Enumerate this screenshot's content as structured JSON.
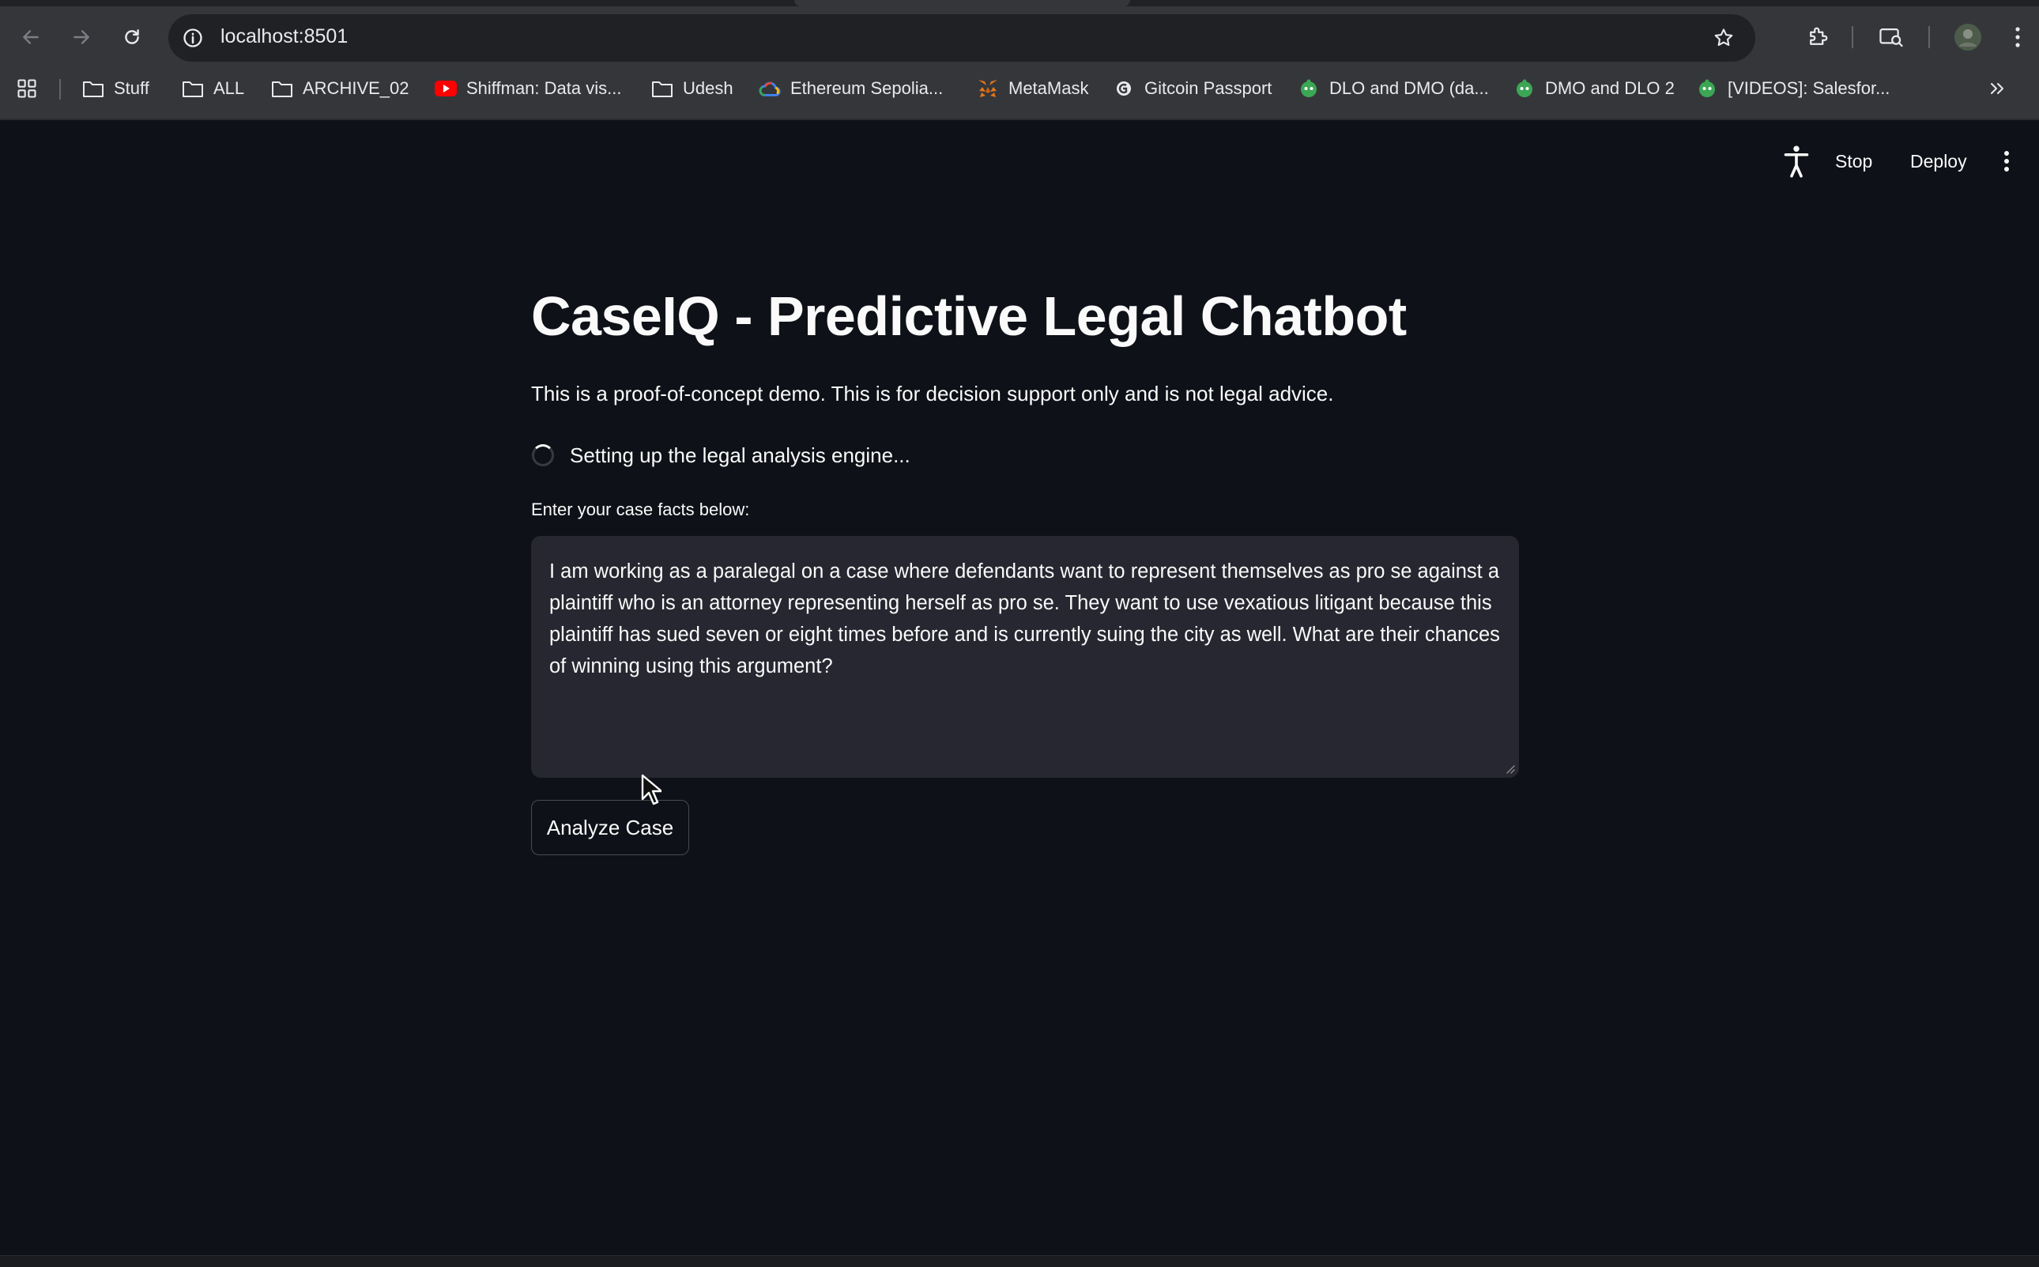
{
  "browser": {
    "url": "localhost:8501",
    "bookmarks": [
      {
        "label": "Stuff",
        "icon": "folder-icon"
      },
      {
        "label": "ALL",
        "icon": "folder-icon"
      },
      {
        "label": "ARCHIVE_02",
        "icon": "folder-icon"
      },
      {
        "label": "Shiffman: Data vis...",
        "icon": "youtube-icon"
      },
      {
        "label": "Udesh",
        "icon": "folder-icon"
      },
      {
        "label": "Ethereum Sepolia...",
        "icon": "google-cloud-icon"
      },
      {
        "label": "MetaMask",
        "icon": "metamask-fox-icon"
      },
      {
        "label": "Gitcoin Passport",
        "icon": "gitcoin-icon"
      },
      {
        "label": "DLO and DMO (da...",
        "icon": "salesforce-astro-icon"
      },
      {
        "label": "DMO and DLO 2",
        "icon": "salesforce-astro-icon"
      },
      {
        "label": "[VIDEOS]: Salesfor...",
        "icon": "salesforce-astro-icon"
      }
    ]
  },
  "app_header": {
    "stop_label": "Stop",
    "deploy_label": "Deploy"
  },
  "main": {
    "title": "CaseIQ - Predictive Legal Chatbot",
    "disclaimer": "This is a proof-of-concept demo. This is for decision support only and is not legal advice.",
    "status_text": "Setting up the legal analysis engine...",
    "input_label": "Enter your case facts below:",
    "case_facts": "I am working as a paralegal on a case where defendants want to represent themselves as pro se against a plaintiff who is an attorney representing herself as pro se. They want to use vexatious litigant because this plaintiff has sued seven or eight times before and is currently suing the city as well. What are their chances of winning using this argument?",
    "analyze_button_label": "Analyze Case"
  },
  "colors": {
    "app_background": "#0e1117",
    "text_area_background": "#262730",
    "browser_chrome": "#35363a"
  }
}
